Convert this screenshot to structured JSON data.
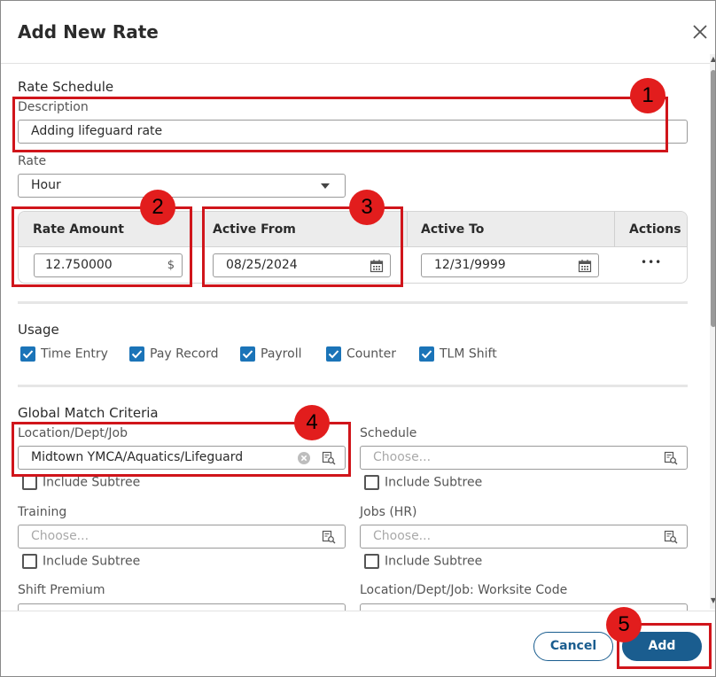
{
  "dialog": {
    "title": "Add New Rate"
  },
  "rate_schedule": {
    "section_title": "Rate Schedule",
    "description_label": "Description",
    "description_value": "Adding lifeguard rate",
    "rate_label": "Rate",
    "rate_value": "Hour"
  },
  "rate_table": {
    "headers": [
      "Rate Amount",
      "Active From",
      "Active To",
      "Actions"
    ],
    "row": {
      "rate_amount": "12.750000",
      "currency_symbol": "$",
      "active_from": "08/25/2024",
      "active_to": "12/31/9999",
      "actions": "•••"
    }
  },
  "usage": {
    "section_title": "Usage",
    "items": [
      {
        "label": "Time Entry",
        "checked": true
      },
      {
        "label": "Pay Record",
        "checked": true
      },
      {
        "label": "Payroll",
        "checked": true
      },
      {
        "label": "Counter",
        "checked": true
      },
      {
        "label": "TLM Shift",
        "checked": true
      }
    ]
  },
  "criteria": {
    "section_title": "Global Match Criteria",
    "location_label": "Location/Dept/Job",
    "location_value": "Midtown YMCA/Aquatics/Lifeguard",
    "schedule_label": "Schedule",
    "schedule_placeholder": "Choose...",
    "training_label": "Training",
    "training_placeholder": "Choose...",
    "jobs_label": "Jobs (HR)",
    "jobs_placeholder": "Choose...",
    "shift_premium_label": "Shift Premium",
    "worksite_label": "Location/Dept/Job: Worksite Code",
    "include_subtree": "Include Subtree"
  },
  "footer": {
    "cancel_label": "Cancel",
    "add_label": "Add"
  },
  "annotations": [
    "1",
    "2",
    "3",
    "4",
    "5"
  ],
  "colors": {
    "accent": "#1a5d8f",
    "checkbox": "#1b74b8",
    "highlight": "#d0151b",
    "badge": "#e21d1d"
  }
}
